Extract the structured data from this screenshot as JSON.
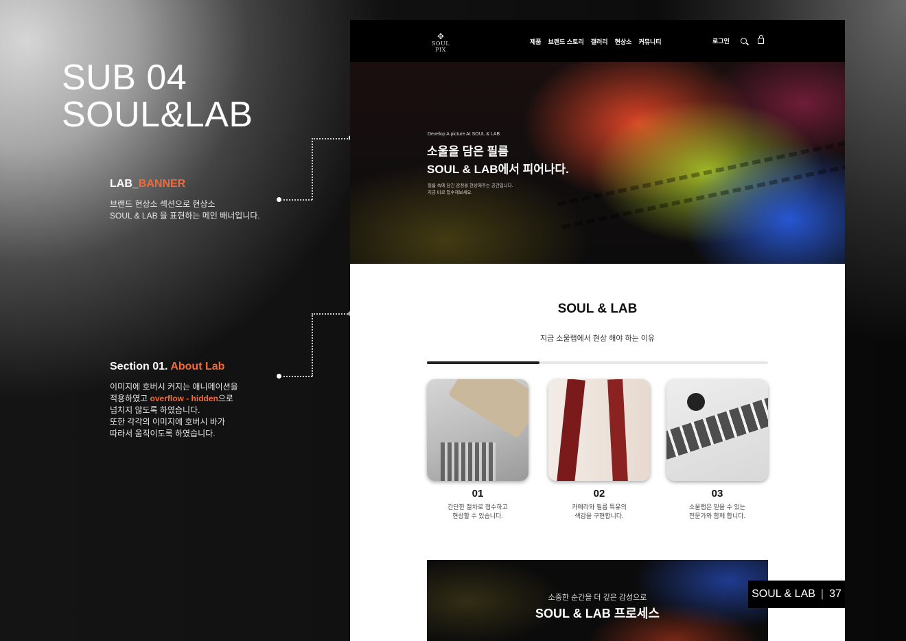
{
  "slide": {
    "title_line1": "SUB 04",
    "title_line2": "SOUL&LAB"
  },
  "notes": [
    {
      "title_prefix": "LAB_",
      "title_accent": "BANNER",
      "lines": [
        "브랜드 현상소 섹션으로 현상소",
        "SOUL & LAB 을 표현하는 메인 배너입니다."
      ]
    },
    {
      "title_prefix": "Section 01. ",
      "title_accent": "About Lab",
      "line1": "이미지에 호버시 커지는 애니메이션을",
      "line2_pre": "적용하였고 ",
      "line2_accent": "overflow - hidden",
      "line2_post": "으로",
      "line3": "넘치지 않도록 하였습니다.",
      "line4": "또한 각각의 이미지에 호버시 바가",
      "line5": "따라서 움직이도록 하였습니다."
    }
  ],
  "site": {
    "logo_text": "SOUL PIX",
    "menu": [
      "제품",
      "브랜드 스토리",
      "갤러리",
      "현상소",
      "커뮤니티"
    ],
    "login": "로그인",
    "hero": {
      "small": "Develop A picture At SOUL & LAB",
      "title_line1": "소울을 담은 필름",
      "title_line2": "SOUL & LAB에서 피어나다.",
      "desc_line1": "필름 속에 담긴 감정을 현상해주는 공간입니다.",
      "desc_line2": "지금 바로 접수해보세요."
    },
    "about": {
      "title": "SOUL & LAB",
      "subtitle": "지금 소울랩에서 현상 해야 하는 이유",
      "progress": 0.33,
      "cards": [
        {
          "num": "01",
          "desc_line1": "간단한 절차로 접수하고",
          "desc_line2": "현상할 수 있습니다."
        },
        {
          "num": "02",
          "desc_line1": "카메라와 필름 특유의",
          "desc_line2": "색감을 구현합니다."
        },
        {
          "num": "03",
          "desc_line1": "소울랩은 믿을 수 있는",
          "desc_line2": "전문가와 함께 합니다."
        }
      ]
    },
    "process": {
      "subtitle": "소중한 순간을 더 깊은 감성으로",
      "title": "SOUL & LAB 프로세스"
    }
  },
  "footer": {
    "label": "SOUL & LAB",
    "page": "37"
  },
  "colors": {
    "accent": "#f06a3a",
    "nav_bg": "#000000"
  }
}
